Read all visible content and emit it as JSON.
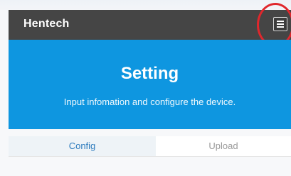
{
  "navbar": {
    "brand": "Hentech",
    "menu_icon": "hamburger-menu-icon"
  },
  "hero": {
    "title": "Setting",
    "subtitle": "Input infomation and configure the device."
  },
  "tabs": [
    {
      "label": "Config",
      "active": true
    },
    {
      "label": "Upload",
      "active": false
    }
  ],
  "colors": {
    "navbar_bg": "#454545",
    "hero_bg": "#0e96e0",
    "active_tab_text": "#2d7bbd",
    "highlight_ring": "#e0272c"
  }
}
